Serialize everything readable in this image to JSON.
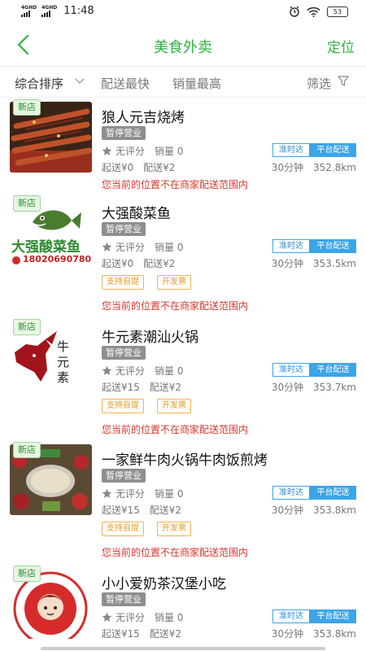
{
  "status_bar": {
    "sim1": "4GHD",
    "sim2": "4GHD",
    "time": "11:48",
    "battery": "53"
  },
  "header": {
    "title": "美食外卖",
    "locate_label": "定位"
  },
  "filters": {
    "sort": "综合排序",
    "fastest": "配送最快",
    "top_sales": "销量最高",
    "filter": "筛选"
  },
  "restaurants": [
    {
      "badge": "新店",
      "name": "狼人元吉烧烤",
      "status": "暂停营业",
      "rating": "无评分",
      "sales": "销量 0",
      "min_order": "起送¥0",
      "delivery_fee": "配送¥2",
      "tag_on_time": "准时达",
      "tag_platform": "平台配送",
      "eta": "30分钟",
      "distance": "352.8km",
      "services": [],
      "warning": "您当前的位置不在商家配送范围内"
    },
    {
      "badge": "新店",
      "name": "大强酸菜鱼",
      "status": "暂停营业",
      "rating": "无评分",
      "sales": "销量 0",
      "min_order": "起送¥0",
      "delivery_fee": "配送¥2",
      "tag_on_time": "准时达",
      "tag_platform": "平台配送",
      "eta": "30分钟",
      "distance": "353.5km",
      "services": [
        "支持自提",
        "开发票"
      ],
      "warning": "您当前的位置不在商家配送范围内",
      "logo_text": "大强酸菜鱼",
      "logo_phone": "18020690780"
    },
    {
      "badge": "新店",
      "name": "牛元素潮汕火锅",
      "status": "暂停营业",
      "rating": "无评分",
      "sales": "销量 0",
      "min_order": "起送¥15",
      "delivery_fee": "配送¥2",
      "tag_on_time": "准时达",
      "tag_platform": "平台配送",
      "eta": "30分钟",
      "distance": "353.7km",
      "services": [
        "支持自提",
        "开发票"
      ],
      "warning": "您当前的位置不在商家配送范围内",
      "logo_text": "牛元素"
    },
    {
      "badge": "新店",
      "name": "一家鲜牛肉火锅牛肉饭煎烤",
      "status": "暂停营业",
      "rating": "无评分",
      "sales": "销量 0",
      "min_order": "起送¥15",
      "delivery_fee": "配送¥2",
      "tag_on_time": "准时达",
      "tag_platform": "平台配送",
      "eta": "30分钟",
      "distance": "353.8km",
      "services": [
        "支持自提",
        "开发票"
      ],
      "warning": "您当前的位置不在商家配送范围内"
    },
    {
      "badge": "新店",
      "name": "小小爱奶茶汉堡小吃",
      "status": "暂停营业",
      "rating": "无评分",
      "sales": "销量 0",
      "min_order": "起送¥15",
      "delivery_fee": "配送¥2",
      "tag_on_time": "准时达",
      "tag_platform": "平台配送",
      "eta": "30分钟",
      "distance": "353.8km",
      "services": [],
      "warning": ""
    }
  ],
  "colors": {
    "brand_green": "#2fb240",
    "closed_gray": "#8e8e8e",
    "delivery_blue": "#3aa5e9",
    "warning_red": "#d9362b",
    "service_orange": "#e29a25"
  }
}
